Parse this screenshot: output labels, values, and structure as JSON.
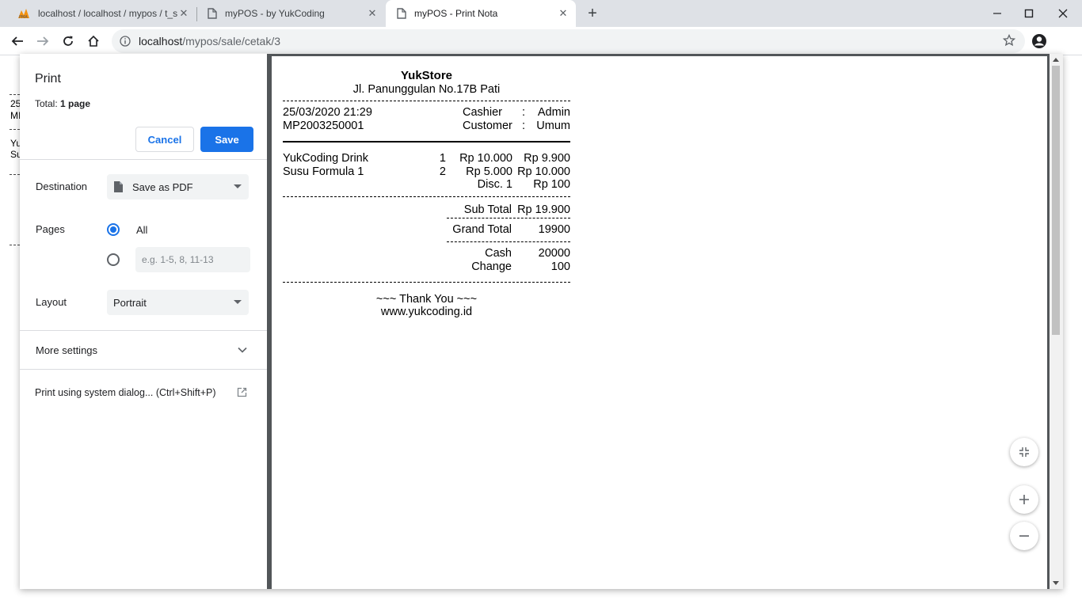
{
  "browser": {
    "tabs": [
      {
        "title": "localhost / localhost / mypos / t_s",
        "icon": "phpmyadmin-icon"
      },
      {
        "title": "myPOS - by YukCoding",
        "icon": "page-icon"
      },
      {
        "title": "myPOS - Print Nota",
        "icon": "page-icon",
        "active": true
      }
    ],
    "url_host": "localhost",
    "url_path": "/mypos/sale/cetak/3"
  },
  "behind_page": {
    "fragments": [
      "25",
      "MI",
      "Yu",
      "Su"
    ]
  },
  "print": {
    "title": "Print",
    "total_label": "Total:",
    "total_value": "1 page",
    "cancel_label": "Cancel",
    "save_label": "Save",
    "destination_label": "Destination",
    "destination_value": "Save as PDF",
    "pages_label": "Pages",
    "pages_all": "All",
    "pages_custom_placeholder": "e.g. 1-5, 8, 11-13",
    "layout_label": "Layout",
    "layout_value": "Portrait",
    "more_settings": "More settings",
    "system_dialog": "Print using system dialog... (Ctrl+Shift+P)",
    "accent": "#1a73e8"
  },
  "receipt": {
    "store": "YukStore",
    "address": "Jl. Panunggulan No.17B Pati",
    "date": "25/03/2020 21:29",
    "invoice": "MP2003250001",
    "cashier_label": "Cashier",
    "cashier_value": "Admin",
    "customer_label": "Customer",
    "customer_value": "Umum",
    "items": [
      {
        "name": "YukCoding Drink",
        "qty": "1",
        "price": "Rp 10.000",
        "total": "Rp 9.900"
      },
      {
        "name": "Susu Formula 1",
        "qty": "2",
        "price": "Rp 5.000",
        "total": "Rp 10.000"
      }
    ],
    "discount_label": "Disc. 1",
    "discount_value": "Rp 100",
    "subtotal_label": "Sub Total",
    "subtotal_value": "Rp 19.900",
    "grand_total_label": "Grand Total",
    "grand_total_value": "19900",
    "cash_label": "Cash",
    "cash_value": "20000",
    "change_label": "Change",
    "change_value": "100",
    "thanks": "~~~ Thank You ~~~",
    "website": "www.yukcoding.id"
  }
}
